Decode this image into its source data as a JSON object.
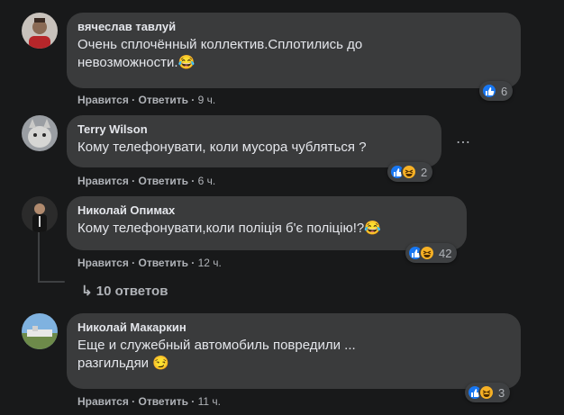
{
  "comments": [
    {
      "author": "вячеслав тавлуй",
      "text1": "Очень сплочённый коллектив.Сплотились до",
      "text2": "невозможности.😂",
      "like": "Нравится",
      "reply": "Ответить",
      "time": "9 ч.",
      "reaction_count": "6"
    },
    {
      "author": "Terry Wilson",
      "text1": "Кому телефонувати, коли мусора чубляться ?",
      "like": "Нравится",
      "reply": "Ответить",
      "time": "6 ч.",
      "reaction_count": "2",
      "more": "⋯"
    },
    {
      "author": "Николай Опимах",
      "text1": "Кому телефонувати,коли поліція б'є поліцію!?😂",
      "like": "Нравится",
      "reply": "Ответить",
      "time": "12 ч.",
      "reaction_count": "42"
    },
    {
      "author": "Николай Макаркин",
      "text1": "Еще и служебный автомобиль повредили ...",
      "text2": "разгильдяи 😏",
      "like": "Нравится",
      "reply": "Ответить",
      "time": "11 ч.",
      "reaction_count": "3"
    }
  ],
  "replies_link": "↳ 10 ответов",
  "separator": " · ",
  "colors": {
    "background": "#18191a",
    "bubble": "#3a3b3c",
    "text": "#e4e6eb",
    "secondary": "#b0b3b8",
    "like": "#1877f2",
    "haha": "#f7b125"
  }
}
